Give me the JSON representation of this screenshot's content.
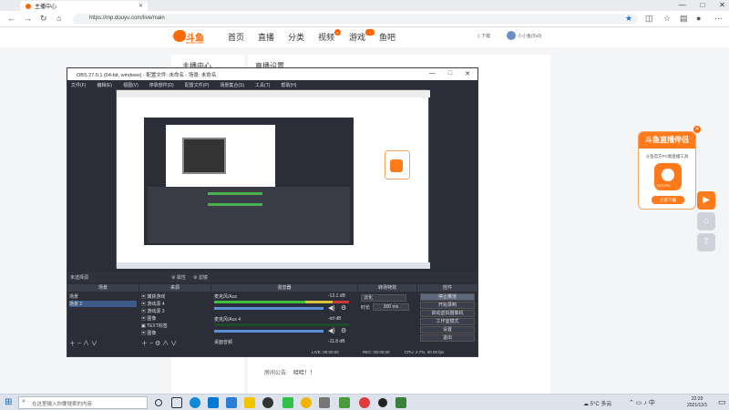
{
  "browser": {
    "tab_title": "主播中心",
    "url": "https://mp.douyu.com/live/main",
    "window_controls": [
      "—",
      "□",
      "✕"
    ]
  },
  "douyu": {
    "logo_text": "斗鱼",
    "logo_domain": "douyu.com",
    "nav": [
      "首页",
      "直播",
      "分类",
      "视频",
      "游戏",
      "鱼吧"
    ],
    "download_label": "下载",
    "user_label": "小小鱼(0v0)",
    "left_title": "主播中心",
    "main_title": "直播设置",
    "notice_label": "房间公告:",
    "notice_value": "哈哈！！"
  },
  "promo": {
    "title": "斗鱼直播伴侣",
    "subtitle": "斗鱼官方PC端直播工具",
    "app_text": "DOUYU",
    "button": "立即下载",
    "close": "✕"
  },
  "side_buttons": [
    "▶",
    "⌂",
    "⇧"
  ],
  "obs": {
    "title": "OBS 27.0.1 (64-bit, windows) - 配置文件: 未命名 - 场景: 未命名",
    "menu": [
      "文件(F)",
      "编辑(E)",
      "视图(V)",
      "停靠部件(D)",
      "配置文件(P)",
      "场景集合(S)",
      "工具(T)",
      "帮助(H)"
    ],
    "source_bar": {
      "label": "未选择源",
      "props": "⚙ 属性",
      "filters": "⚙ 滤镜"
    },
    "docks": {
      "scenes": {
        "header": "场景",
        "items": [
          "场景",
          "场景 2"
        ]
      },
      "sources": {
        "header": "来源",
        "items": [
          "捕获游戏",
          "游戏源 4",
          "游戏源 3",
          "图像",
          "TEXT标签",
          "图像"
        ]
      },
      "mixer": {
        "header": "混音器",
        "channels": [
          {
            "name": "麦克风/Aux",
            "db": "-13.1 dB"
          },
          {
            "name": "麦克风/Aux 4",
            "db": "-inf dB"
          },
          {
            "name": "桌面音频",
            "db": "-11.8 dB"
          }
        ]
      },
      "transitions": {
        "header": "转场特效",
        "type": "淡化",
        "duration_label": "时长",
        "duration": "300 ms"
      },
      "controls": {
        "header": "控件",
        "buttons": [
          "停止推流",
          "开始录制",
          "启动虚拟摄像机",
          "工作室模式",
          "设置",
          "退出"
        ]
      }
    },
    "status": {
      "live": "LIVE: 00:00:00",
      "rec": "REC: 00:00:00",
      "cpu": "CPU: 2.7%, 30.00 fps"
    }
  },
  "taskbar": {
    "search_placeholder": "在这里输入你要搜索的内容",
    "weather": "5°C 多云",
    "time": "22:29",
    "date": "2021/12/1"
  }
}
